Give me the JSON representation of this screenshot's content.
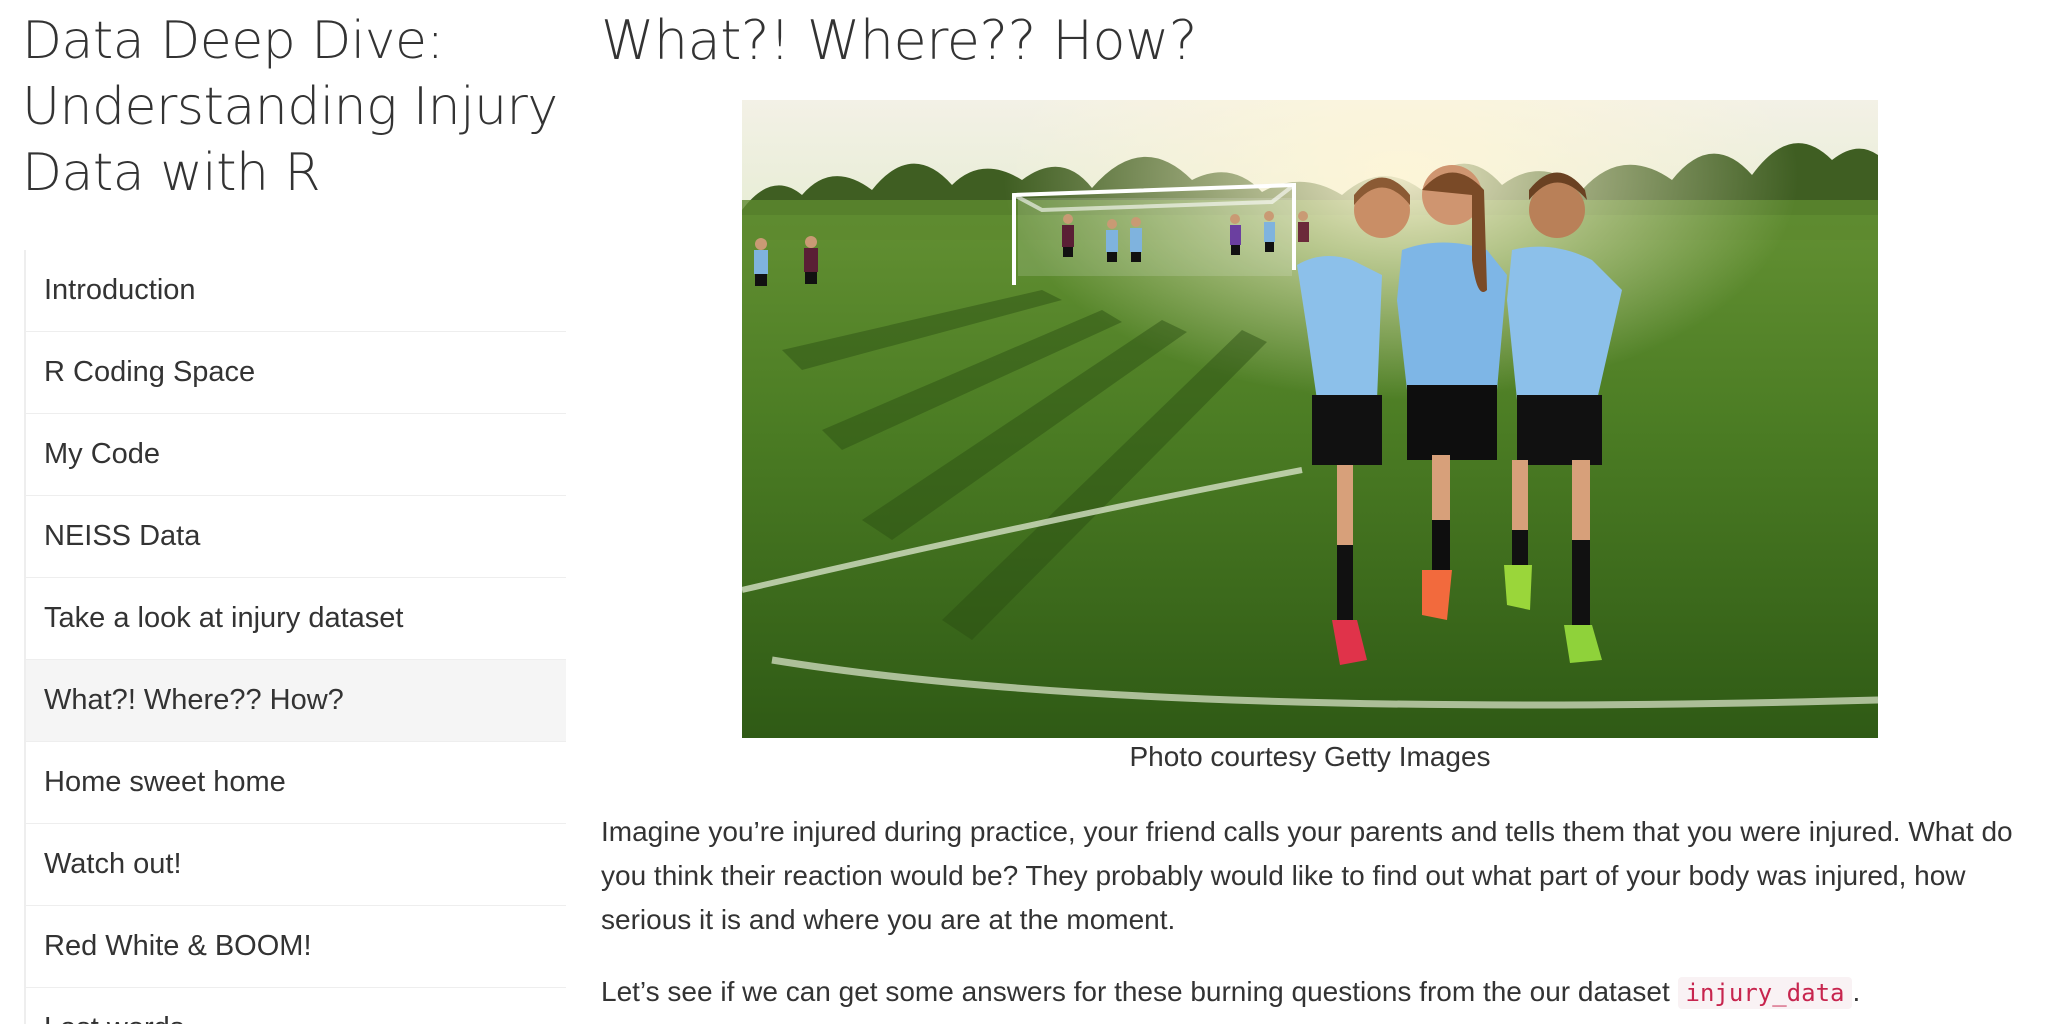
{
  "sidebar": {
    "title": "Data Deep Dive: Understanding Injury Data with R",
    "items": [
      {
        "label": "Introduction"
      },
      {
        "label": "R Coding Space"
      },
      {
        "label": "My Code"
      },
      {
        "label": "NEISS Data"
      },
      {
        "label": "Take a look at injury dataset"
      },
      {
        "label": "What?! Where?? How?",
        "active": true
      },
      {
        "label": "Home sweet home"
      },
      {
        "label": "Watch out!"
      },
      {
        "label": "Red White & BOOM!"
      },
      {
        "label": "Last words"
      }
    ]
  },
  "main": {
    "heading": "What?! Where?? How?",
    "image_caption": "Photo courtesy Getty Images",
    "paragraph1": "Imagine you’re injured during practice, your friend calls your parents and tells them that you were injured. What do you think their reaction would be? They probably would like to find out what part of your body was injured, how serious it is and where you are at the moment.",
    "paragraph2_text": "Let’s see if we can get some answers for these burning questions from the our dataset ",
    "paragraph2_code": "injury_data",
    "paragraph2_end": "."
  },
  "colors": {
    "text": "#333333",
    "active_bg": "#f5f5f5",
    "code_text": "#c7254e",
    "code_bg": "#f9f2f4"
  }
}
